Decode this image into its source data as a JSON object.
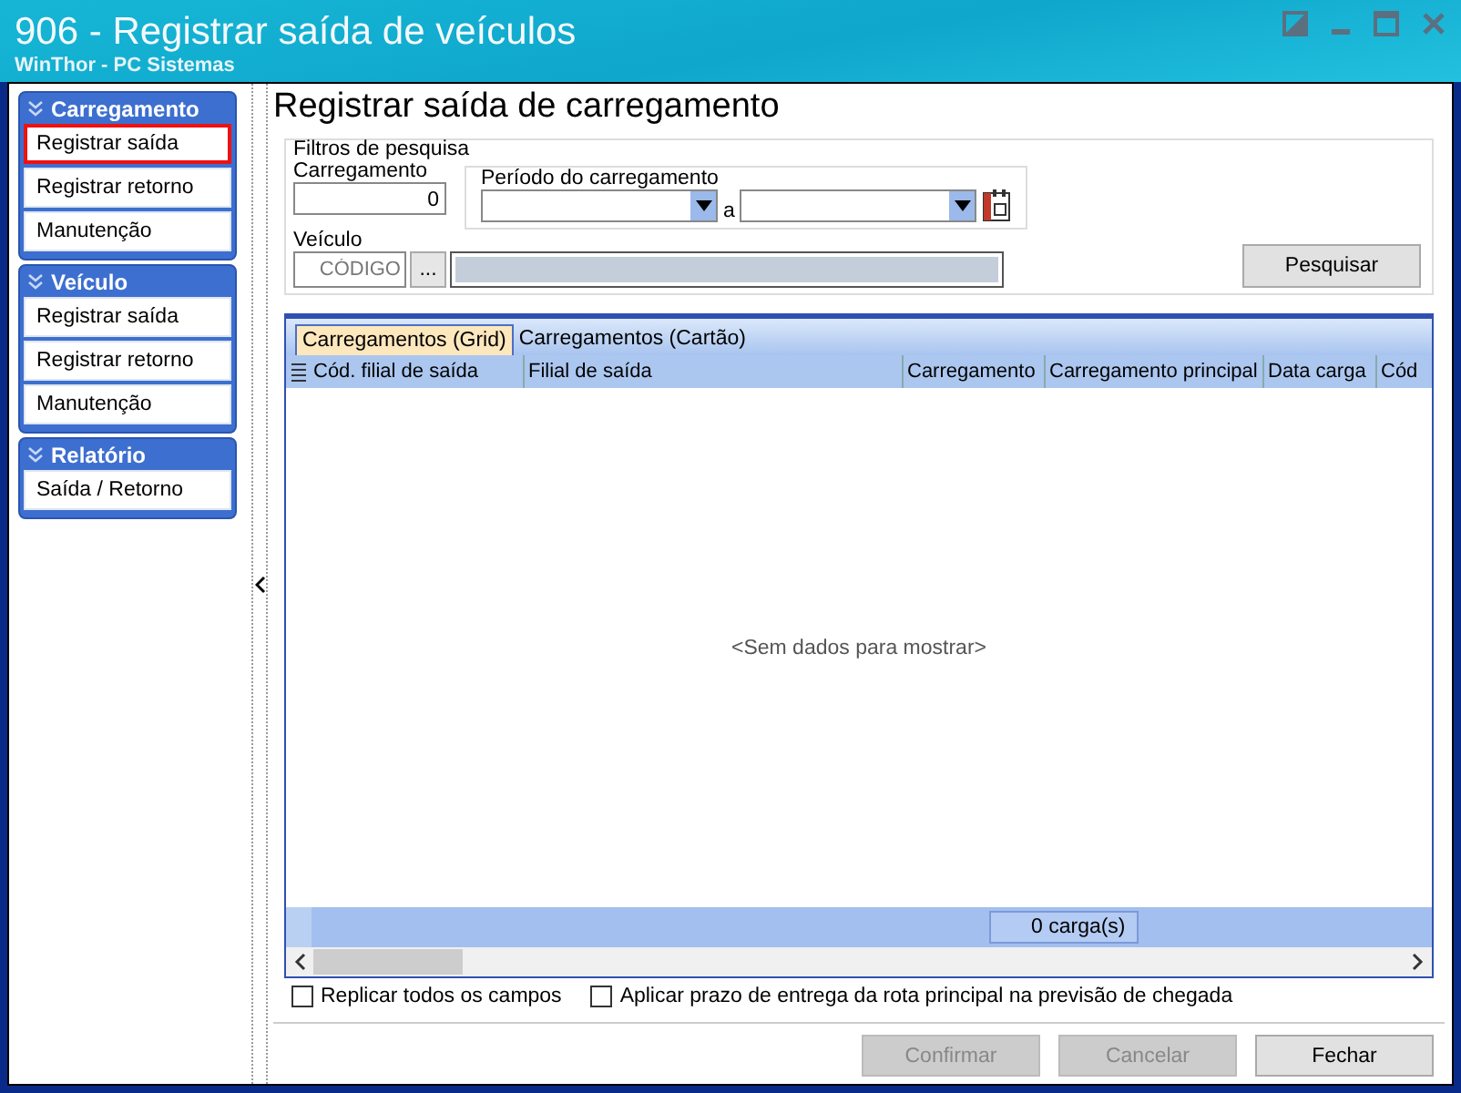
{
  "window": {
    "title": "906 - Registrar saída de veículos",
    "subtitle": "WinThor - PC Sistemas"
  },
  "sidebar": {
    "groups": [
      {
        "title": "Carregamento",
        "expanded": true,
        "items": [
          {
            "label": "Registrar saída",
            "selected": true
          },
          {
            "label": "Registrar retorno",
            "selected": false
          },
          {
            "label": "Manutenção",
            "selected": false
          }
        ]
      },
      {
        "title": "Veículo",
        "expanded": true,
        "items": [
          {
            "label": "Registrar saída",
            "selected": false
          },
          {
            "label": "Registrar retorno",
            "selected": false
          },
          {
            "label": "Manutenção",
            "selected": false
          }
        ]
      },
      {
        "title": "Relatório",
        "expanded": true,
        "items": [
          {
            "label": "Saída / Retorno",
            "selected": false
          }
        ]
      }
    ]
  },
  "page_title": "Registrar saída de carregamento",
  "filters": {
    "legend": "Filtros de pesquisa",
    "carregamento_label": "Carregamento",
    "carregamento_value": "0",
    "periodo_legend": "Período do carregamento",
    "periodo_separator": "a",
    "veiculo_label": "Veículo",
    "veiculo_placeholder": "CÓDIGO",
    "browse_button": "...",
    "search_button": "Pesquisar"
  },
  "tabs": [
    {
      "label": "Carregamentos (Grid)",
      "selected": true
    },
    {
      "label": "Carregamentos (Cartão)",
      "selected": false
    }
  ],
  "table": {
    "columns": [
      "Cód. filial de saída",
      "Filial de saída",
      "Carregamento",
      "Carregamento principal",
      "Data carga",
      "Cód"
    ],
    "empty_text": "<Sem dados para mostrar>",
    "footer_count": "0 carga(s)"
  },
  "options": [
    {
      "label": "Replicar todos os campos",
      "checked": false
    },
    {
      "label": "Aplicar prazo de entrega da rota principal na previsão de chegada",
      "checked": false
    }
  ],
  "buttons": [
    {
      "label": "Confirmar",
      "disabled": true
    },
    {
      "label": "Cancelar",
      "disabled": true
    },
    {
      "label": "Fechar",
      "disabled": false
    }
  ]
}
